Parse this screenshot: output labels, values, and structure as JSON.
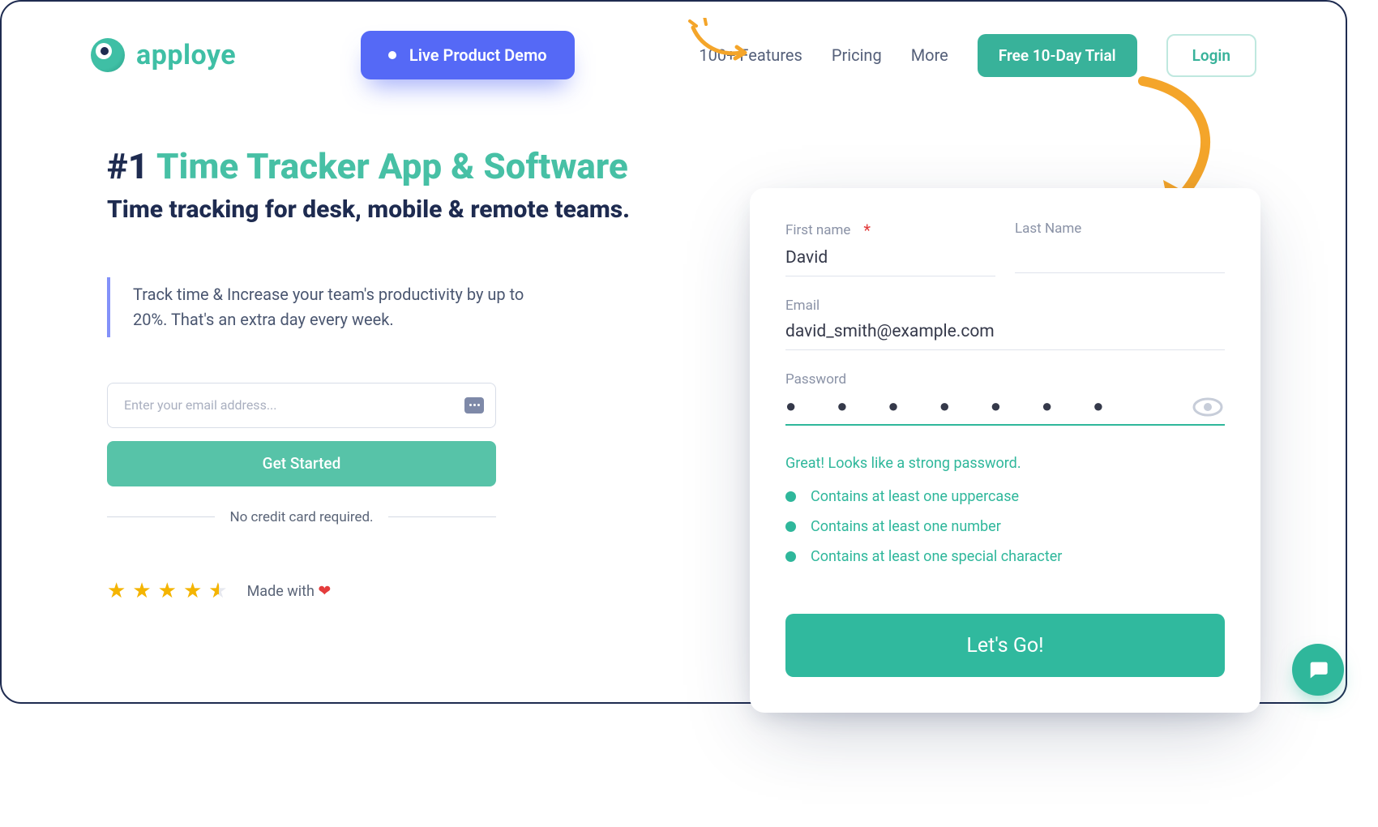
{
  "brand": {
    "name": "apploye"
  },
  "header": {
    "demo": "Live Product Demo",
    "nav": {
      "features": "100+ Features",
      "pricing": "Pricing",
      "more": "More"
    },
    "trial": "Free 10-Day Trial",
    "login": "Login"
  },
  "hero": {
    "h1_num": "#1",
    "h1_teal": "Time Tracker App & Software",
    "sub": "Time tracking for desk, mobile & remote teams.",
    "quote": "Track time & Increase your team's productivity by up to 20%. That's an extra day every week.",
    "email_placeholder": "Enter your email address...",
    "get_started": "Get Started",
    "no_cc": "No credit card required.",
    "made_with": "Made with"
  },
  "signup": {
    "first_label": "First name",
    "first_value": "David",
    "last_label": "Last Name",
    "last_value": "",
    "email_label": "Email",
    "email_value": "david_smith@example.com",
    "password_label": "Password",
    "password_value": "●  ●  ●  ●  ●  ●  ●",
    "strength": "Great! Looks like a strong password.",
    "check1": "Contains at least one uppercase",
    "check2": "Contains at least one number",
    "check3": "Contains at least one special character",
    "go": "Let's Go!"
  },
  "colors": {
    "teal": "#3fbfa5",
    "indigo": "#5569f6",
    "dark": "#1e2b50",
    "amber": "#f4b400"
  }
}
